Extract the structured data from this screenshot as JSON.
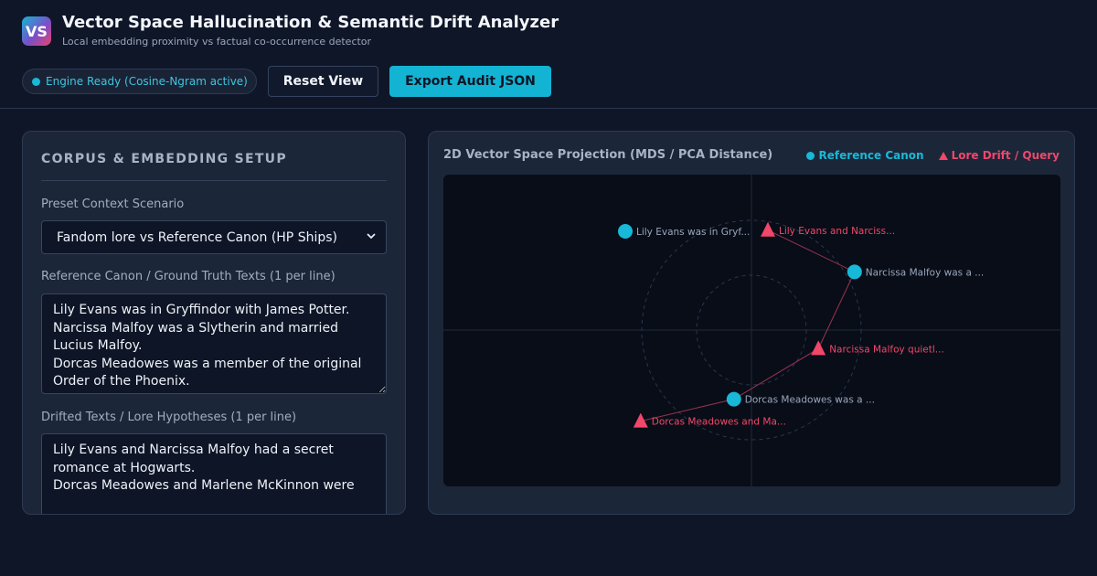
{
  "header": {
    "logo_text": "VS",
    "title": "Vector Space Hallucination & Semantic Drift Analyzer",
    "subtitle": "Local embedding proximity vs factual co-occurrence detector"
  },
  "toolbar": {
    "status_text": "Engine Ready (Cosine-Ngram active)",
    "reset_label": "Reset View",
    "export_label": "Export Audit JSON"
  },
  "setup": {
    "heading": "CORPUS & EMBEDDING SETUP",
    "scenario_label": "Preset Context Scenario",
    "scenario_selected": "Fandom lore vs Reference Canon (HP Ships)",
    "reference_label": "Reference Canon / Ground Truth Texts (1 per line)",
    "reference_text": "Lily Evans was in Gryffindor with James Potter.\nNarcissa Malfoy was a Slytherin and married Lucius Malfoy.\nDorcas Meadowes was a member of the original Order of the Phoenix.",
    "drift_label": "Drifted Texts / Lore Hypotheses (1 per line)",
    "drift_text": "Lily Evans and Narcissa Malfoy had a secret romance at Hogwarts.\nDorcas Meadowes and Marlene McKinnon were"
  },
  "visualization": {
    "title": "2D Vector Space Projection (MDS / PCA Distance)",
    "legend": {
      "reference": "Reference Canon",
      "drift": "Lore Drift / Query"
    },
    "colors": {
      "reference": "#17b8d8",
      "drift": "#f0476b",
      "link": "#b23a5a"
    },
    "points": [
      {
        "kind": "reference",
        "label": "Lily Evans was in Gryf...",
        "x": -1.15,
        "y": 0.9
      },
      {
        "kind": "drift",
        "label": "Lily Evans and Narciss...",
        "x": 0.15,
        "y": 0.91
      },
      {
        "kind": "reference",
        "label": "Narcissa Malfoy was a ...",
        "x": 0.94,
        "y": 0.53
      },
      {
        "kind": "drift",
        "label": "Narcissa Malfoy quietl...",
        "x": 0.61,
        "y": -0.17
      },
      {
        "kind": "reference",
        "label": "Dorcas Meadowes was a ...",
        "x": -0.16,
        "y": -0.63
      },
      {
        "kind": "drift",
        "label": "Dorcas Meadowes and Ma...",
        "x": -1.01,
        "y": -0.83
      }
    ],
    "links": [
      [
        1,
        2
      ],
      [
        2,
        3
      ],
      [
        3,
        4
      ],
      [
        4,
        5
      ]
    ]
  }
}
